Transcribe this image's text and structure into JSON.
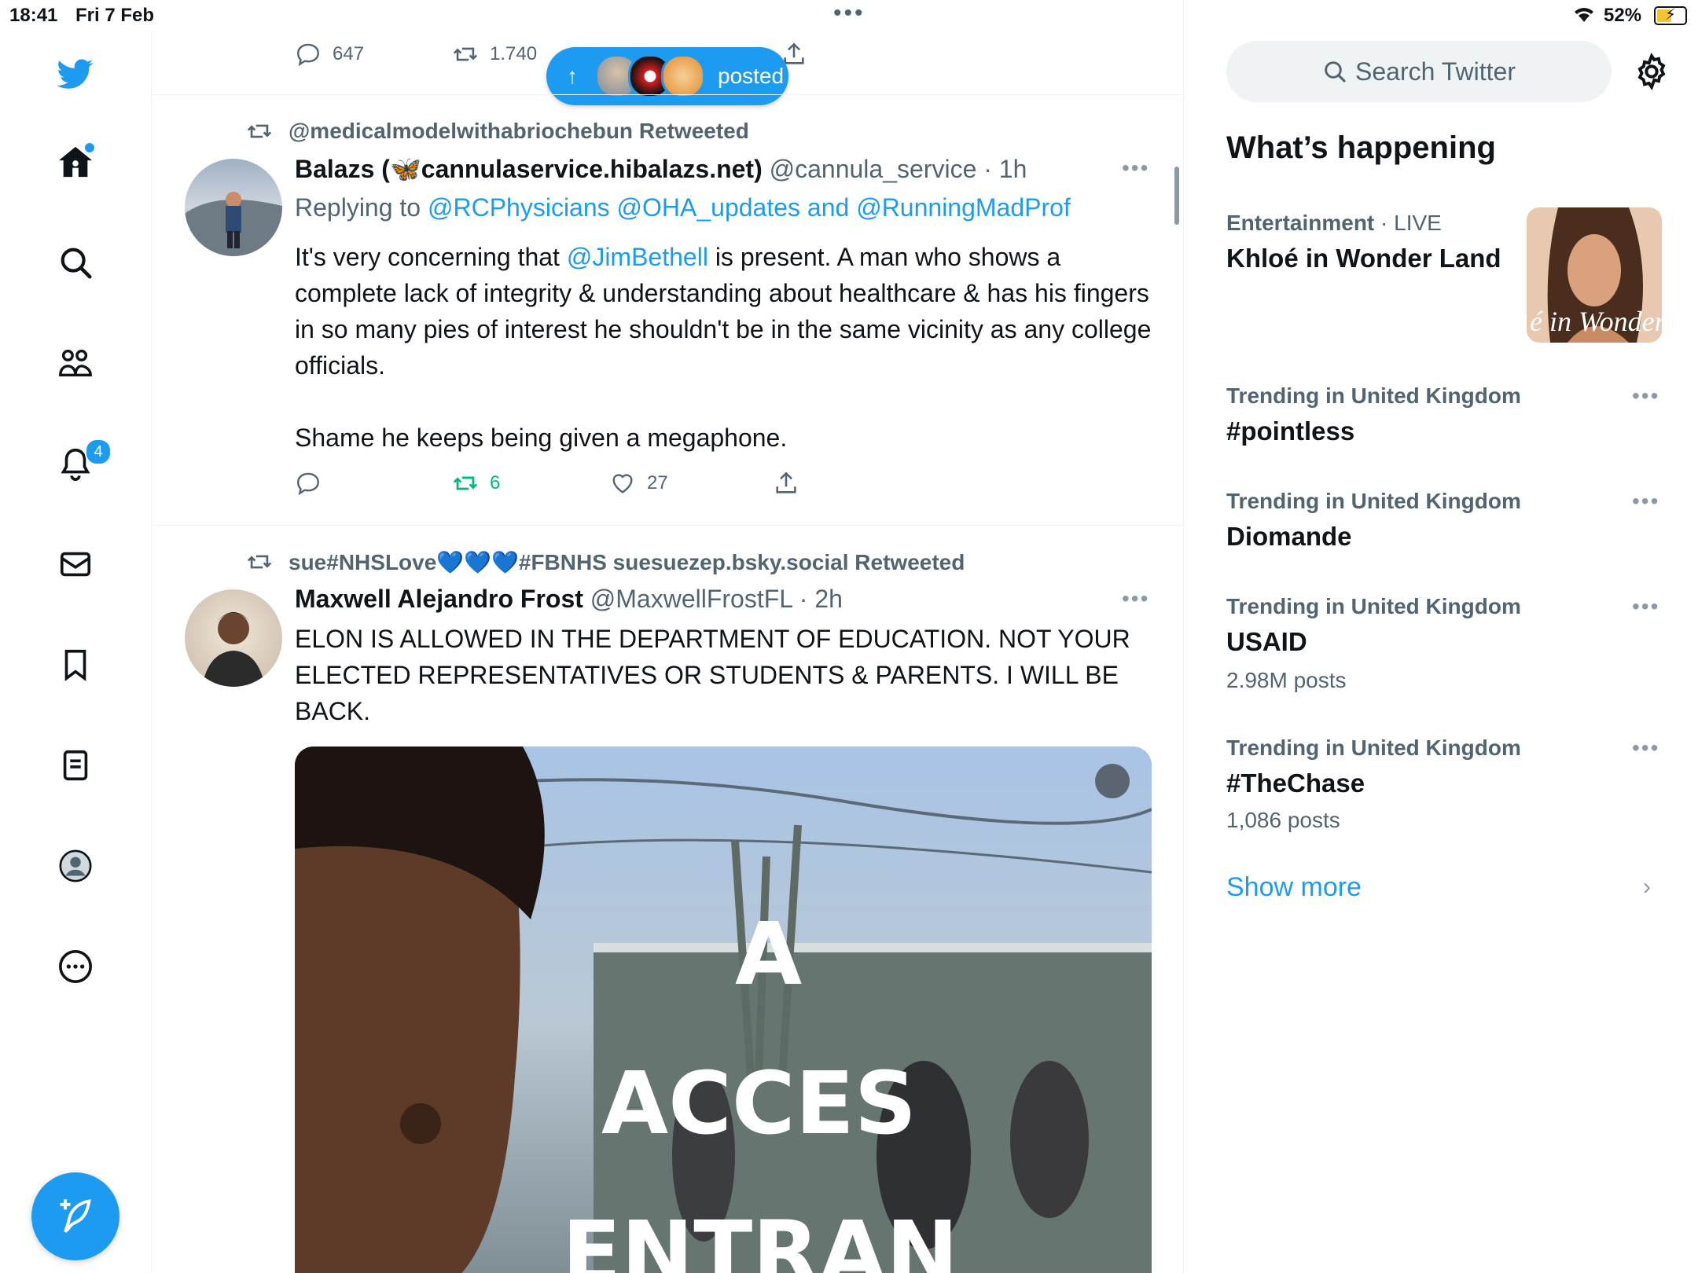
{
  "status_bar": {
    "time": "18:41",
    "date": "Fri 7 Feb",
    "battery": "52%"
  },
  "nav": {
    "items": [
      {
        "name": "twitter-logo-icon"
      },
      {
        "name": "home-icon"
      },
      {
        "name": "search-icon"
      },
      {
        "name": "communities-icon"
      },
      {
        "name": "notifications-icon"
      },
      {
        "name": "messages-icon"
      },
      {
        "name": "bookmarks-icon"
      },
      {
        "name": "lists-icon"
      },
      {
        "name": "profile-icon"
      },
      {
        "name": "more-icon"
      }
    ],
    "notifications_badge": "4"
  },
  "feed": {
    "prev_tweet_actions": {
      "replies": "647",
      "retweets": "1.740"
    },
    "posted_pill": {
      "label": "posted"
    },
    "tweet1": {
      "retweeted_by": "@medicalmodelwithabriochebun Retweeted",
      "name_prefix": "Balazs (",
      "name_suffix": "cannulaservice.hibalazs.net)",
      "handle": "@cannula_service",
      "time": "· 1h",
      "replying_to_label": "Replying to ",
      "replying_to_links": "@RCPhysicians @OHA_updates and @RunningMadProf",
      "text_before": "It's very concerning that ",
      "mention": "@JimBethell",
      "text_after": " is present. A man who shows a complete lack of integrity & understanding about healthcare & has his fingers in so many pies of interest he shouldn't be in the same vicinity as any college officials.",
      "text_para2": "Shame he keeps being given a megaphone.",
      "retweets": "6",
      "likes": "27"
    },
    "tweet2": {
      "retweeted_by": "sue#NHSLove💙💙💙#FBNHS suesuezep.bsky.social Retweeted",
      "name": "Maxwell Alejandro Frost",
      "handle": "@MaxwellFrostFL",
      "time": "· 2h",
      "text": "ELON IS ALLOWED IN THE DEPARTMENT OF EDUCATION. NOT YOUR ELECTED REPRESENTATIVES OR STUDENTS & PARENTS. I WILL BE BACK.",
      "media_overlay_text_top": "A",
      "media_overlay_text_mid": "ACCES",
      "media_overlay_text_bottom": "ENTRAN"
    }
  },
  "sidebar": {
    "search_placeholder": "Search Twitter",
    "section_title": "What’s happening",
    "featured": {
      "category": "Entertainment",
      "live": "· LIVE",
      "title": "Khloé in Wonder Land",
      "image_text": "é in Wonder L"
    },
    "trends": [
      {
        "meta": "Trending in United Kingdom",
        "name": "#pointless",
        "count": ""
      },
      {
        "meta": "Trending in United Kingdom",
        "name": "Diomande",
        "count": ""
      },
      {
        "meta": "Trending in United Kingdom",
        "name": "USAID",
        "count": "2.98M posts"
      },
      {
        "meta": "Trending in United Kingdom",
        "name": "#TheChase",
        "count": "1,086 posts"
      }
    ],
    "show_more": "Show more"
  },
  "colors": {
    "accent": "#1d9bf0",
    "retweet_green": "#00ba7c",
    "secondary_text": "#536471"
  }
}
